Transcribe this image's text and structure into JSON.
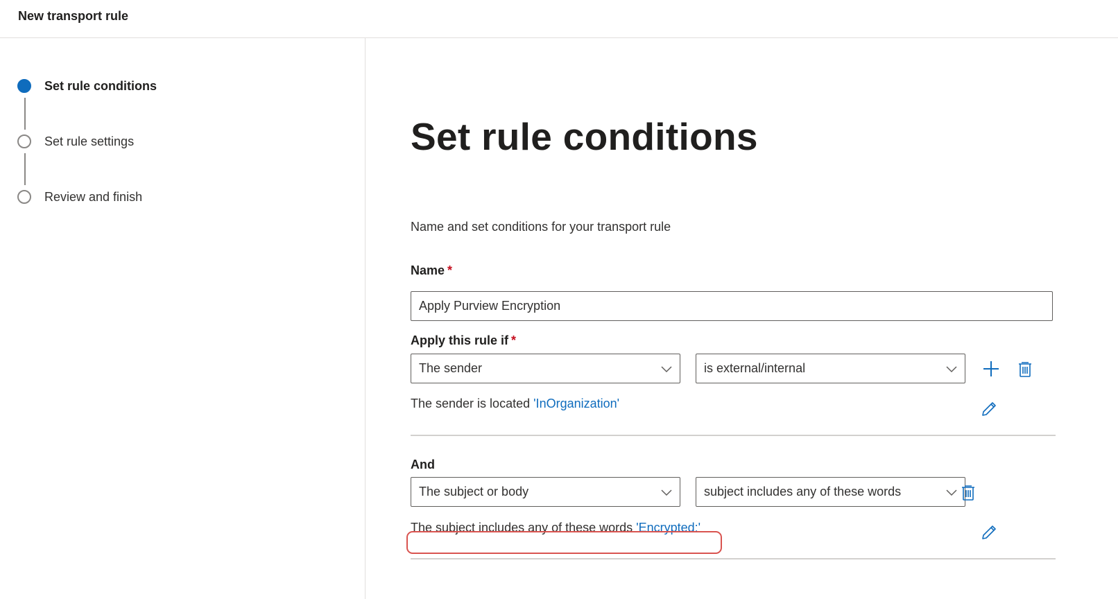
{
  "header": {
    "title": "New transport rule"
  },
  "steps": [
    {
      "label": "Set rule conditions",
      "state": "active"
    },
    {
      "label": "Set rule settings",
      "state": "pending"
    },
    {
      "label": "Review and finish",
      "state": "pending"
    }
  ],
  "main": {
    "title": "Set rule conditions",
    "subtitle": "Name and set conditions for your transport rule",
    "name": {
      "label": "Name",
      "required_mark": "*",
      "value": "Apply Purview Encryption"
    },
    "apply_if": {
      "label": "Apply this rule if",
      "required_mark": "*",
      "condition1": "The sender",
      "condition2": "is external/internal",
      "summary_prefix": "The sender is located",
      "summary_value": "'InOrganization'"
    },
    "and": {
      "label": "And",
      "condition1": "The subject or body",
      "condition2": "subject includes any of these words",
      "summary_prefix": "The subject includes any of these words",
      "summary_value": "'Encrypted:'"
    }
  },
  "icons": {
    "add": "plus-icon",
    "delete": "trash-icon",
    "edit": "pencil-icon",
    "dropdown": "chevron-down-icon"
  },
  "colors": {
    "accent": "#0f6cbd",
    "required": "#c50f1f",
    "highlight": "#d9534f"
  }
}
